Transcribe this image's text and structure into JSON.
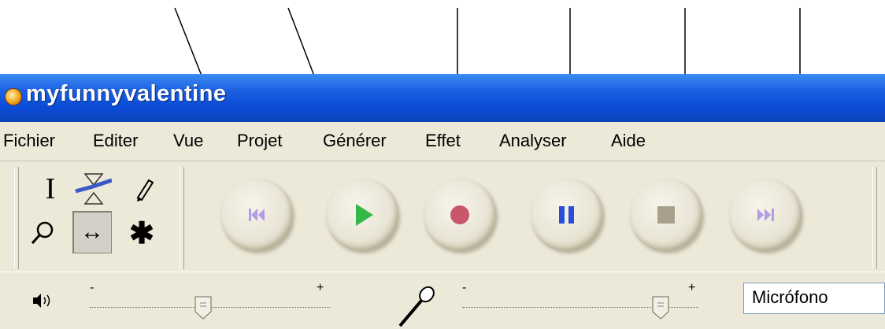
{
  "window": {
    "title": "myfunnyvalentine"
  },
  "menu": [
    "Fichier",
    "Editer",
    "Vue",
    "Projet",
    "Générer",
    "Effet",
    "Analyser",
    "Aide"
  ],
  "tools": {
    "selection": "I",
    "zoom": "⚲",
    "timeshift": "↔",
    "multi": "✱"
  },
  "transport": [
    "skip-to-start",
    "play",
    "record",
    "pause",
    "stop",
    "skip-to-end"
  ],
  "mixer": {
    "playback_min": "-",
    "playback_max": "+",
    "playback_level": 0.48,
    "record_min": "-",
    "record_max": "+",
    "record_level": 0.84,
    "input_source": "Micrófono"
  },
  "colors": {
    "play": "#35b84a",
    "record": "#c8576a",
    "pause": "#2a4fd6",
    "stop": "#a8a08a",
    "skip": "#b39be6"
  }
}
